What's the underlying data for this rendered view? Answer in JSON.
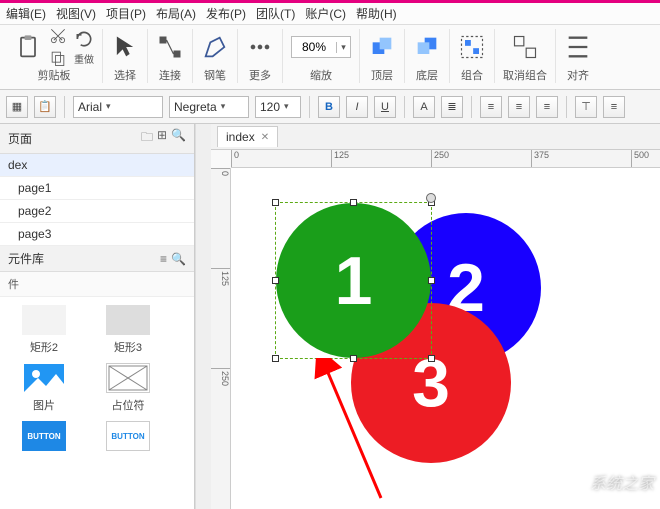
{
  "menu": [
    "编辑(E)",
    "视图(V)",
    "项目(P)",
    "布局(A)",
    "发布(P)",
    "团队(T)",
    "账户(C)",
    "帮助(H)"
  ],
  "toolbar": {
    "clipboard": "剪贴板",
    "select": "选择",
    "connect": "连接",
    "pen": "钢笔",
    "more": "更多",
    "zoom_value": "80%",
    "zoom_label": "缩放",
    "top_layer": "顶层",
    "bottom_layer": "底层",
    "group": "组合",
    "ungroup": "取消组合",
    "align": "对齐",
    "undo": "重做"
  },
  "format": {
    "font": "Arial",
    "weight": "Negreta",
    "size": "120"
  },
  "sidebar": {
    "pages_title": "页面",
    "lib_title": "元件库",
    "pages": [
      "dex",
      "page1",
      "page2",
      "page3"
    ],
    "cat": "件",
    "items": [
      {
        "label": "矩形2"
      },
      {
        "label": "矩形3"
      },
      {
        "label": "图片"
      },
      {
        "label": "占位符"
      },
      {
        "label": "BUTTON"
      },
      {
        "label": "BUTTON"
      }
    ]
  },
  "tab": {
    "name": "index"
  },
  "ruler_h": [
    "0",
    "125",
    "250",
    "375",
    "500"
  ],
  "ruler_v": [
    "0",
    "125",
    "250"
  ],
  "shapes": {
    "one": "1",
    "two": "2",
    "three": "3"
  },
  "watermark": "系统之家"
}
